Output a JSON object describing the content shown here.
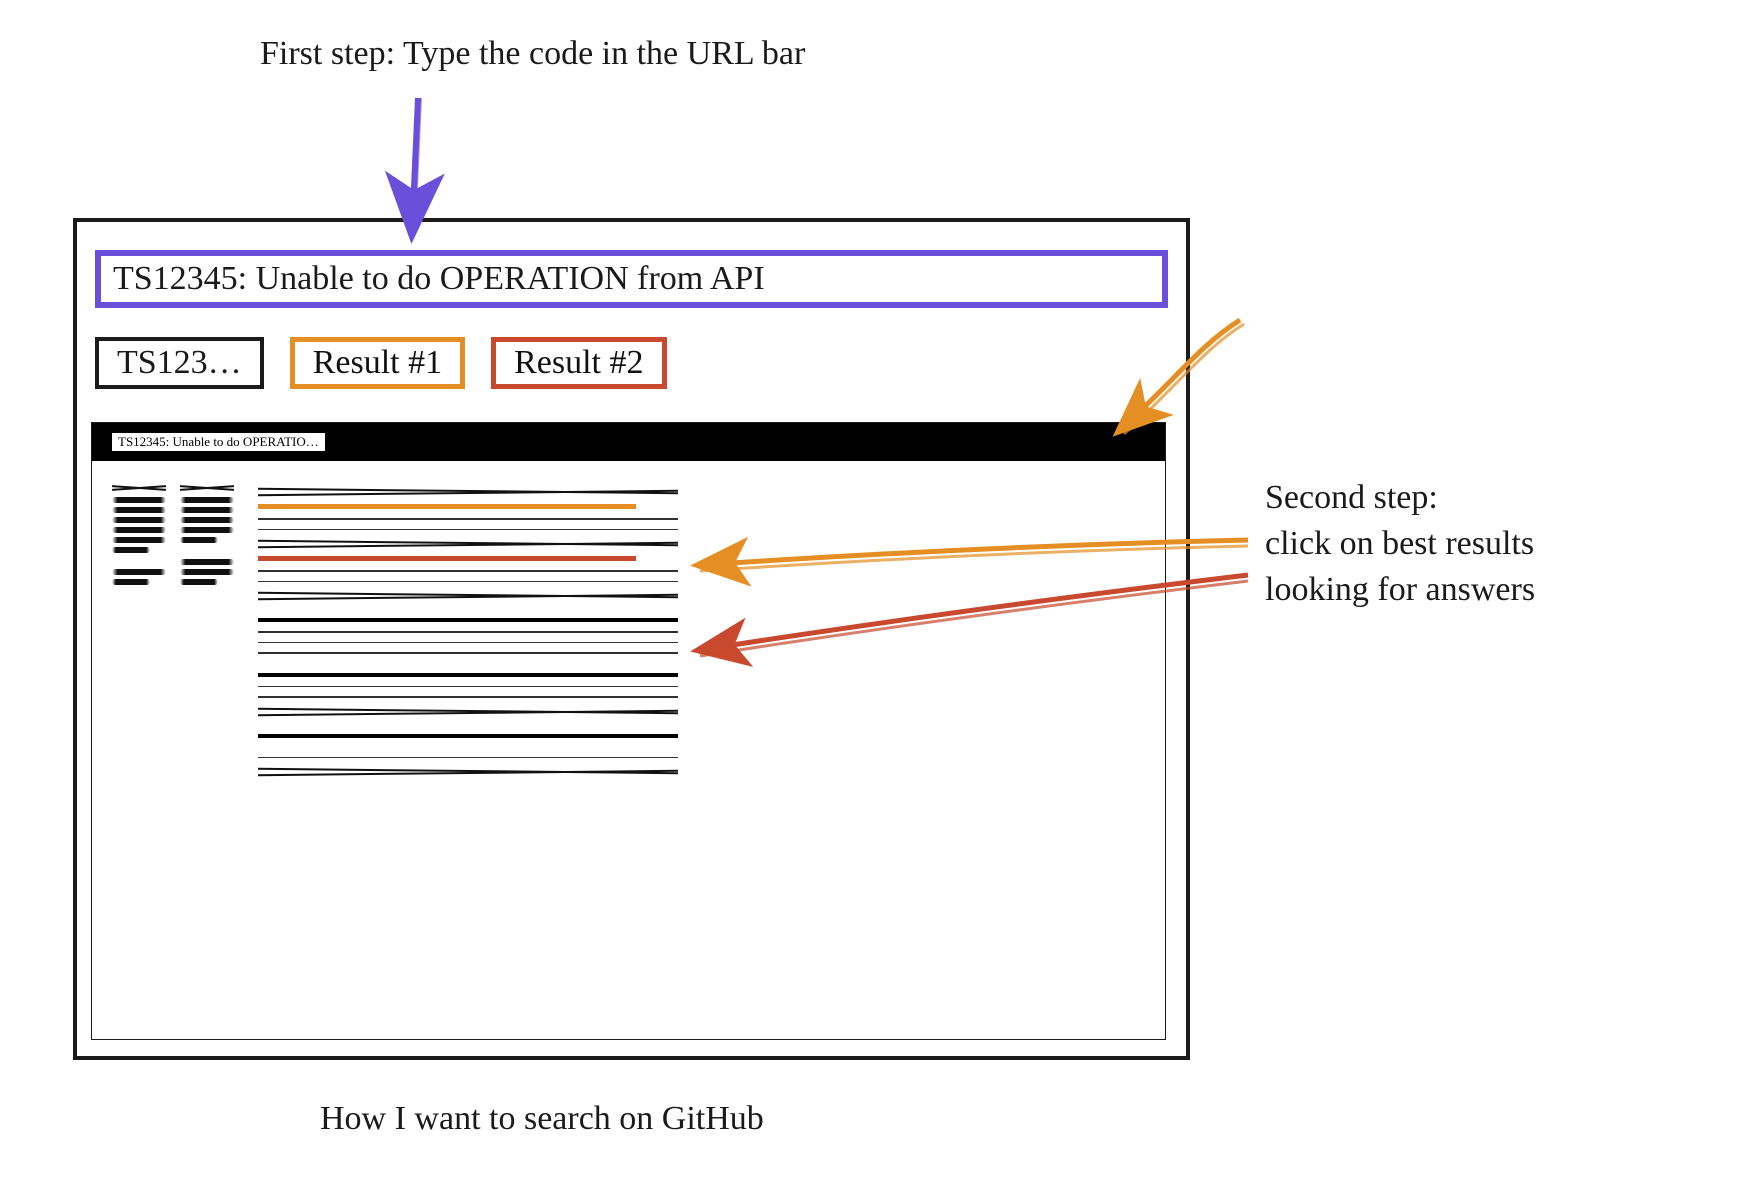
{
  "annotations": {
    "step1": "First step: Type the code in the URL bar",
    "step2_line1": "Second step:",
    "step2_line2": "click on best results",
    "step2_line3": "looking for answers"
  },
  "caption": "How I want to search on GitHub",
  "url_bar": {
    "value": "TS12345: Unable to do OPERATION from API"
  },
  "tabs": {
    "active": "TS123…",
    "result1": "Result #1",
    "result2": "Result #2"
  },
  "results_panel": {
    "title_chip": "TS12345: Unable to do OPERATIO…"
  },
  "colors": {
    "purple": "#6A4FDA",
    "orange": "#E48E23",
    "red": "#C8492E"
  }
}
